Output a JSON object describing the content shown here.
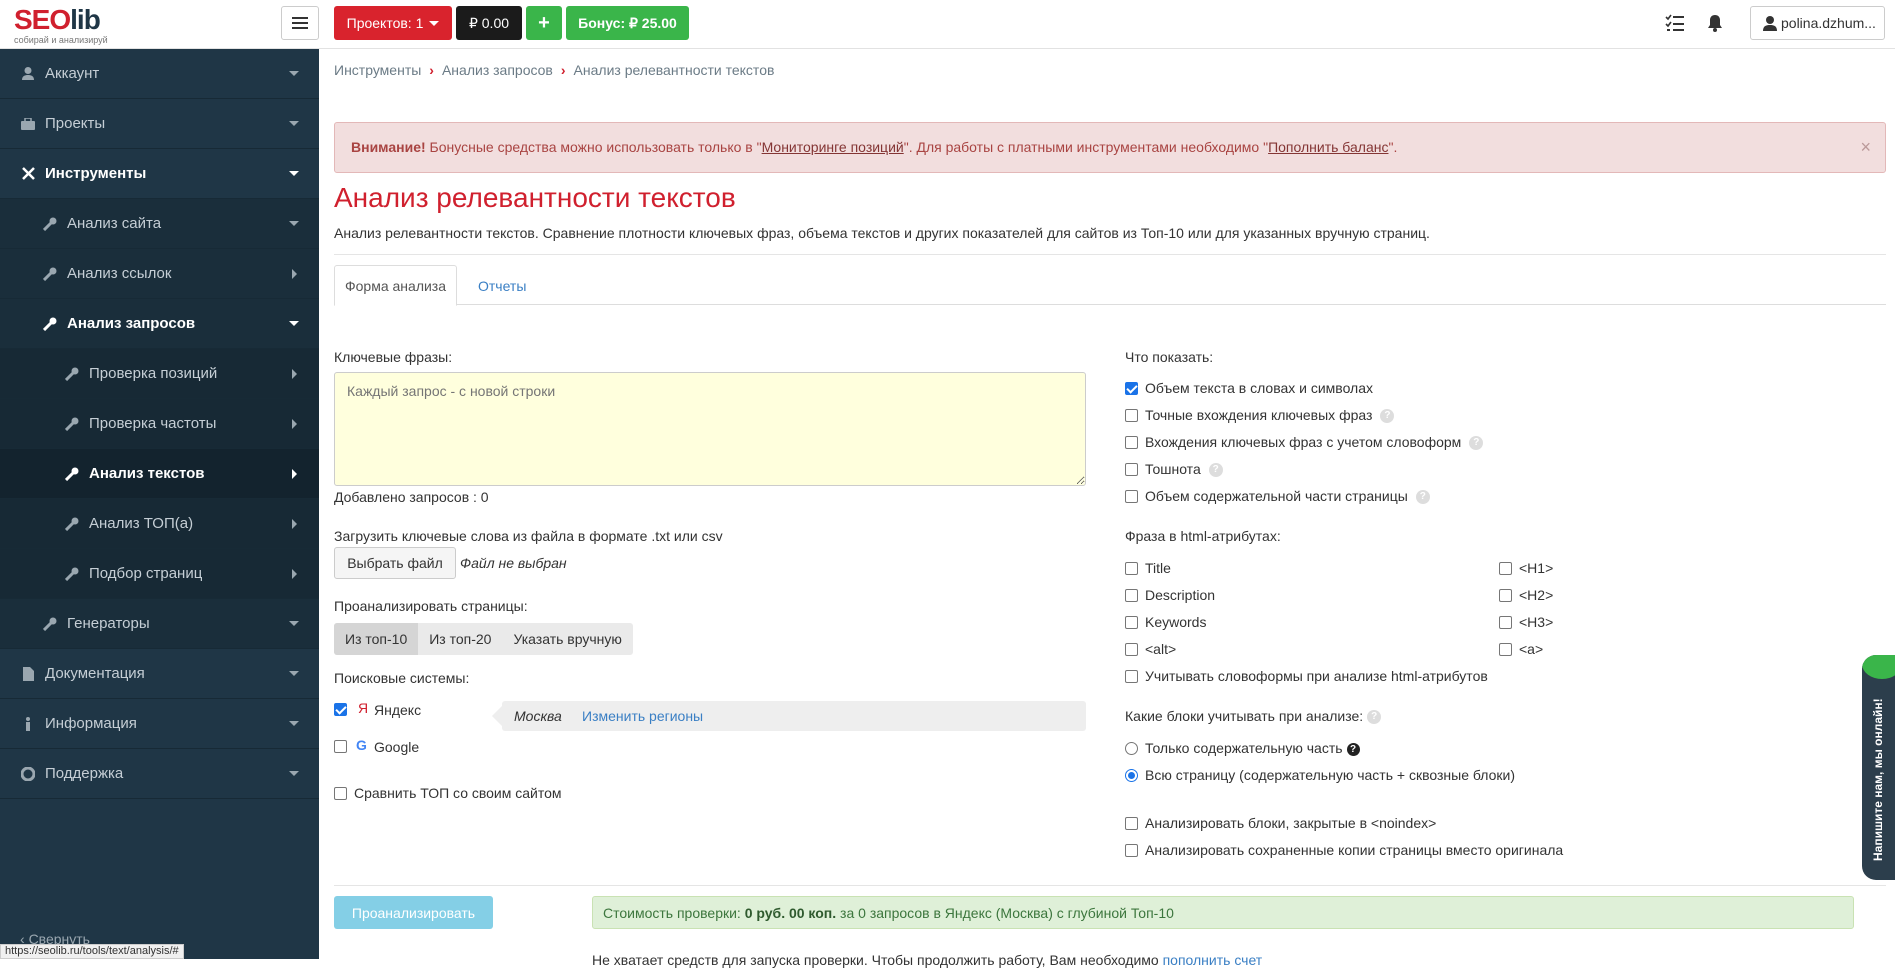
{
  "logo": {
    "seo": "SEO",
    "lib": "lib",
    "slogan": "собирай и анализируй"
  },
  "topbar": {
    "projects_label": "Проектов: 1",
    "balance": "₽ 0.00",
    "plus": "+",
    "bonus": "Бонус: ₽ 25.00",
    "user": "polina.dzhum..."
  },
  "sidebar": {
    "items": [
      {
        "label": "Аккаунт",
        "icon": "user-icon"
      },
      {
        "label": "Проекты",
        "icon": "briefcase-icon"
      },
      {
        "label": "Инструменты",
        "icon": "tools-icon"
      },
      {
        "label": "Анализ сайта",
        "icon": "wrench-icon"
      },
      {
        "label": "Анализ ссылок",
        "icon": "wrench-icon"
      },
      {
        "label": "Анализ запросов",
        "icon": "wrench-icon"
      },
      {
        "label": "Проверка позиций",
        "icon": "wrench-icon"
      },
      {
        "label": "Проверка частоты",
        "icon": "wrench-icon"
      },
      {
        "label": "Анализ текстов",
        "icon": "wrench-icon"
      },
      {
        "label": "Анализ ТОП(а)",
        "icon": "wrench-icon"
      },
      {
        "label": "Подбор страниц",
        "icon": "wrench-icon"
      },
      {
        "label": "Генераторы",
        "icon": "wrench-icon"
      },
      {
        "label": "Документация",
        "icon": "document-icon"
      },
      {
        "label": "Информация",
        "icon": "info-icon"
      },
      {
        "label": "Поддержка",
        "icon": "lifebuoy-icon"
      }
    ],
    "collapse": "Свернуть",
    "status_url": "https://seolib.ru/tools/text/analysis/#"
  },
  "breadcrumb": [
    "Инструменты",
    "Анализ запросов",
    "Анализ релевантности текстов"
  ],
  "alert": {
    "strong": "Внимание!",
    "text1": " Бонусные средства можно использовать только в \"",
    "link1": "Мониторинге позиций",
    "text2": "\". Для работы с платными инструментами необходимо \"",
    "link2": "Пополнить баланс",
    "text3": "\".",
    "close": "×"
  },
  "page": {
    "title": "Анализ релевантности текстов",
    "description": "Анализ релевантности текстов. Сравнение плотности ключевых фраз, объема текстов и других показателей для сайтов из Топ-10 или для указанных вручную страниц."
  },
  "tabs": [
    "Форма анализа",
    "Отчеты"
  ],
  "form": {
    "keywords_label": "Ключевые фразы:",
    "keywords_placeholder": "Каждый запрос - с новой строки",
    "added": "Добавлено запросов : 0",
    "upload_label": "Загрузить ключевые слова из файла в формате .txt или csv",
    "choose_file": "Выбрать файл",
    "no_file": "Файл не выбран",
    "analyze_pages_label": "Проанализировать страницы:",
    "page_options": [
      "Из топ-10",
      "Из топ-20",
      "Указать вручную"
    ],
    "search_label": "Поисковые системы:",
    "yandex": "Яндекс",
    "google": "Google",
    "region_city": "Москва",
    "change_regions": "Изменить регионы",
    "compare_top": "Сравнить ТОП со своим сайтом"
  },
  "right": {
    "show_label": "Что показать:",
    "show_options": [
      "Объем текста в словах и символах",
      "Точные вхождения ключевых фраз",
      "Вхождения ключевых фраз с учетом словоформ",
      "Тошнота",
      "Объем содержательной части страницы"
    ],
    "html_label": "Фраза в html-атрибутах:",
    "html_left": [
      "Title",
      "Description",
      "Keywords",
      "<alt>"
    ],
    "html_right": [
      "<H1>",
      "<H2>",
      "<H3>",
      "<a>"
    ],
    "wordforms": "Учитывать словоформы при анализе html-атрибутов",
    "blocks_label": "Какие блоки учитывать при анализе:",
    "block_options": [
      "Только содержательную часть",
      "Всю страницу (содержательную часть + сквозные блоки)"
    ],
    "noindex": "Анализировать блоки, закрытые в <noindex>",
    "cached": "Анализировать сохраненные копии страницы вместо оригинала"
  },
  "footer": {
    "analyze_button": "Проанализировать",
    "cost_prefix": "Стоимость проверки: ",
    "cost_value": "0 руб. 00 коп.",
    "cost_suffix": " за 0 запросов в Яндекс (Москва) с глубиной Топ-10",
    "not_enough": "Не хватает средств для запуска проверки. Чтобы продолжить работу, Вам необходимо ",
    "top_up": "пополнить счет"
  },
  "chat": {
    "text": "Напишите нам, мы онлайн!"
  },
  "colors": {
    "brand_red": "#d9232d",
    "sidebar": "#1f3646",
    "green": "#3ab54a",
    "link": "#3a7fc4"
  }
}
